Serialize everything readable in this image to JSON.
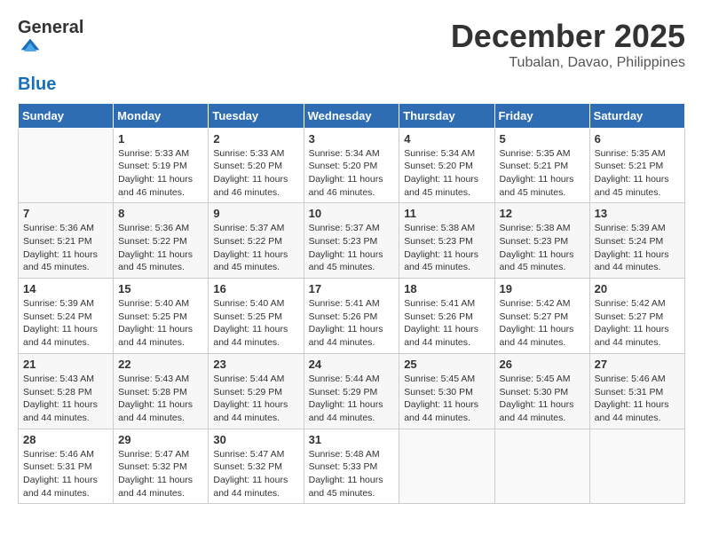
{
  "header": {
    "logo_general": "General",
    "logo_blue": "Blue",
    "month_year": "December 2025",
    "location": "Tubalan, Davao, Philippines"
  },
  "days_of_week": [
    "Sunday",
    "Monday",
    "Tuesday",
    "Wednesday",
    "Thursday",
    "Friday",
    "Saturday"
  ],
  "weeks": [
    [
      {
        "day": "",
        "info": ""
      },
      {
        "day": "1",
        "info": "Sunrise: 5:33 AM\nSunset: 5:19 PM\nDaylight: 11 hours\nand 46 minutes."
      },
      {
        "day": "2",
        "info": "Sunrise: 5:33 AM\nSunset: 5:20 PM\nDaylight: 11 hours\nand 46 minutes."
      },
      {
        "day": "3",
        "info": "Sunrise: 5:34 AM\nSunset: 5:20 PM\nDaylight: 11 hours\nand 46 minutes."
      },
      {
        "day": "4",
        "info": "Sunrise: 5:34 AM\nSunset: 5:20 PM\nDaylight: 11 hours\nand 45 minutes."
      },
      {
        "day": "5",
        "info": "Sunrise: 5:35 AM\nSunset: 5:21 PM\nDaylight: 11 hours\nand 45 minutes."
      },
      {
        "day": "6",
        "info": "Sunrise: 5:35 AM\nSunset: 5:21 PM\nDaylight: 11 hours\nand 45 minutes."
      }
    ],
    [
      {
        "day": "7",
        "info": "Sunrise: 5:36 AM\nSunset: 5:21 PM\nDaylight: 11 hours\nand 45 minutes."
      },
      {
        "day": "8",
        "info": "Sunrise: 5:36 AM\nSunset: 5:22 PM\nDaylight: 11 hours\nand 45 minutes."
      },
      {
        "day": "9",
        "info": "Sunrise: 5:37 AM\nSunset: 5:22 PM\nDaylight: 11 hours\nand 45 minutes."
      },
      {
        "day": "10",
        "info": "Sunrise: 5:37 AM\nSunset: 5:23 PM\nDaylight: 11 hours\nand 45 minutes."
      },
      {
        "day": "11",
        "info": "Sunrise: 5:38 AM\nSunset: 5:23 PM\nDaylight: 11 hours\nand 45 minutes."
      },
      {
        "day": "12",
        "info": "Sunrise: 5:38 AM\nSunset: 5:23 PM\nDaylight: 11 hours\nand 45 minutes."
      },
      {
        "day": "13",
        "info": "Sunrise: 5:39 AM\nSunset: 5:24 PM\nDaylight: 11 hours\nand 44 minutes."
      }
    ],
    [
      {
        "day": "14",
        "info": "Sunrise: 5:39 AM\nSunset: 5:24 PM\nDaylight: 11 hours\nand 44 minutes."
      },
      {
        "day": "15",
        "info": "Sunrise: 5:40 AM\nSunset: 5:25 PM\nDaylight: 11 hours\nand 44 minutes."
      },
      {
        "day": "16",
        "info": "Sunrise: 5:40 AM\nSunset: 5:25 PM\nDaylight: 11 hours\nand 44 minutes."
      },
      {
        "day": "17",
        "info": "Sunrise: 5:41 AM\nSunset: 5:26 PM\nDaylight: 11 hours\nand 44 minutes."
      },
      {
        "day": "18",
        "info": "Sunrise: 5:41 AM\nSunset: 5:26 PM\nDaylight: 11 hours\nand 44 minutes."
      },
      {
        "day": "19",
        "info": "Sunrise: 5:42 AM\nSunset: 5:27 PM\nDaylight: 11 hours\nand 44 minutes."
      },
      {
        "day": "20",
        "info": "Sunrise: 5:42 AM\nSunset: 5:27 PM\nDaylight: 11 hours\nand 44 minutes."
      }
    ],
    [
      {
        "day": "21",
        "info": "Sunrise: 5:43 AM\nSunset: 5:28 PM\nDaylight: 11 hours\nand 44 minutes."
      },
      {
        "day": "22",
        "info": "Sunrise: 5:43 AM\nSunset: 5:28 PM\nDaylight: 11 hours\nand 44 minutes."
      },
      {
        "day": "23",
        "info": "Sunrise: 5:44 AM\nSunset: 5:29 PM\nDaylight: 11 hours\nand 44 minutes."
      },
      {
        "day": "24",
        "info": "Sunrise: 5:44 AM\nSunset: 5:29 PM\nDaylight: 11 hours\nand 44 minutes."
      },
      {
        "day": "25",
        "info": "Sunrise: 5:45 AM\nSunset: 5:30 PM\nDaylight: 11 hours\nand 44 minutes."
      },
      {
        "day": "26",
        "info": "Sunrise: 5:45 AM\nSunset: 5:30 PM\nDaylight: 11 hours\nand 44 minutes."
      },
      {
        "day": "27",
        "info": "Sunrise: 5:46 AM\nSunset: 5:31 PM\nDaylight: 11 hours\nand 44 minutes."
      }
    ],
    [
      {
        "day": "28",
        "info": "Sunrise: 5:46 AM\nSunset: 5:31 PM\nDaylight: 11 hours\nand 44 minutes."
      },
      {
        "day": "29",
        "info": "Sunrise: 5:47 AM\nSunset: 5:32 PM\nDaylight: 11 hours\nand 44 minutes."
      },
      {
        "day": "30",
        "info": "Sunrise: 5:47 AM\nSunset: 5:32 PM\nDaylight: 11 hours\nand 44 minutes."
      },
      {
        "day": "31",
        "info": "Sunrise: 5:48 AM\nSunset: 5:33 PM\nDaylight: 11 hours\nand 45 minutes."
      },
      {
        "day": "",
        "info": ""
      },
      {
        "day": "",
        "info": ""
      },
      {
        "day": "",
        "info": ""
      }
    ]
  ]
}
